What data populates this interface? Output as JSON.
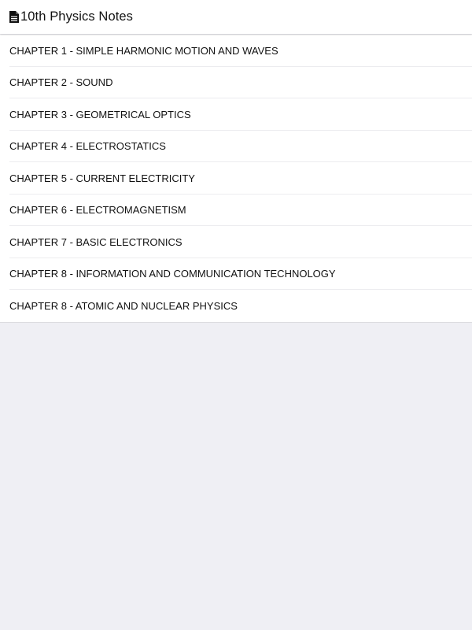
{
  "header": {
    "icon": "document-icon",
    "title": "10th Physics Notes"
  },
  "chapters": [
    {
      "label": "CHAPTER 1 - SIMPLE HARMONIC MOTION AND WAVES"
    },
    {
      "label": "CHAPTER 2 - SOUND"
    },
    {
      "label": "CHAPTER 3 - GEOMETRICAL OPTICS"
    },
    {
      "label": "CHAPTER 4 - ELECTROSTATICS"
    },
    {
      "label": "CHAPTER 5 - CURRENT ELECTRICITY"
    },
    {
      "label": "CHAPTER 6 - ELECTROMAGNETISM"
    },
    {
      "label": "CHAPTER 7 - BASIC ELECTRONICS"
    },
    {
      "label": "CHAPTER 8 - INFORMATION AND COMMUNICATION TECHNOLOGY"
    },
    {
      "label": "CHAPTER 8 - ATOMIC AND NUCLEAR PHYSICS"
    }
  ],
  "colors": {
    "background": "#efeff4",
    "surface": "#ffffff",
    "text": "#111111"
  }
}
